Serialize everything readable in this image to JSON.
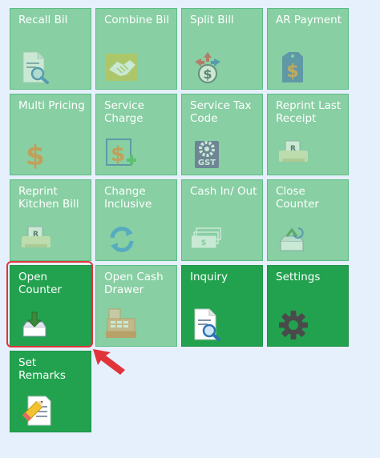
{
  "tiles": [
    {
      "id": "recall-bill",
      "label": "Recall Bil",
      "icon": "document-search-icon",
      "state": "disabled"
    },
    {
      "id": "combine-bill",
      "label": "Combine Bil",
      "icon": "handshake-icon",
      "state": "disabled"
    },
    {
      "id": "split-bill",
      "label": "Split Bill",
      "icon": "split-dollar-icon",
      "state": "disabled"
    },
    {
      "id": "ar-payment",
      "label": "AR Payment",
      "icon": "dollar-tag-icon",
      "state": "disabled"
    },
    {
      "id": "multi-pricing",
      "label": "Multi Pricing",
      "icon": "dollar-icon",
      "state": "disabled"
    },
    {
      "id": "service-charge",
      "label": "Service\nCharge",
      "icon": "dollar-plus-icon",
      "state": "disabled"
    },
    {
      "id": "service-tax-code",
      "label": "Service Tax\nCode",
      "icon": "gst-gear-icon",
      "state": "disabled"
    },
    {
      "id": "reprint-last-receipt",
      "label": "Reprint Last\nReceipt",
      "icon": "receipt-printer-icon",
      "state": "disabled"
    },
    {
      "id": "reprint-kitchen-bill",
      "label": "Reprint\nKitchen Bill",
      "icon": "receipt-printer-icon",
      "state": "disabled"
    },
    {
      "id": "change-inclusive",
      "label": "Change\nInclusive",
      "icon": "refresh-icon",
      "state": "disabled"
    },
    {
      "id": "cash-in-out",
      "label": "Cash In/ Out",
      "icon": "cash-notes-icon",
      "state": "disabled"
    },
    {
      "id": "close-counter",
      "label": "Close\nCounter",
      "icon": "drawer-close-icon",
      "state": "disabled"
    },
    {
      "id": "open-counter",
      "label": "Open\nCounter",
      "icon": "drawer-open-icon",
      "state": "enabled"
    },
    {
      "id": "open-cash-drawer",
      "label": "Open Cash\nDrawer",
      "icon": "cash-register-icon",
      "state": "disabled"
    },
    {
      "id": "inquiry",
      "label": "Inquiry",
      "icon": "document-search-icon",
      "state": "enabled"
    },
    {
      "id": "settings",
      "label": "Settings",
      "icon": "gear-icon",
      "state": "enabled"
    },
    {
      "id": "set-remarks",
      "label": "Set Remarks",
      "icon": "note-pencil-icon",
      "state": "enabled"
    }
  ],
  "colors": {
    "background": "#e6f0fc",
    "tile_enabled": "#22a24f",
    "tile_disabled": "#88cfa3",
    "highlight": "#e0343a"
  }
}
